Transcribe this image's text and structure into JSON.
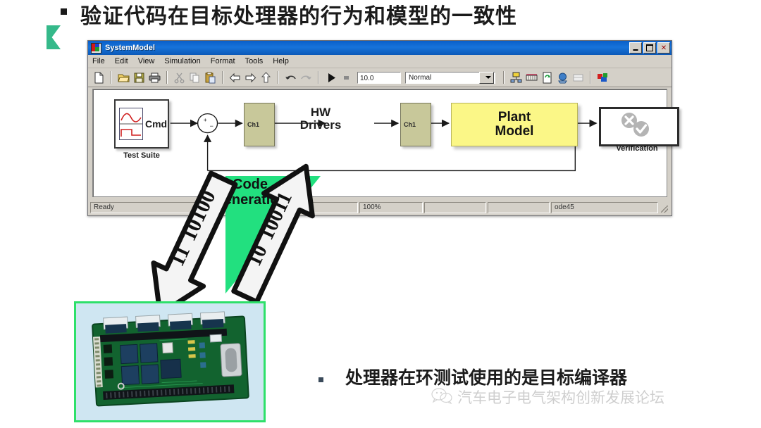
{
  "slide": {
    "bullet": "▪",
    "title": "验证代码在目标处理器的行为和模型的一致性",
    "caption": "处理器在环测试使用的是目标编译器"
  },
  "window": {
    "title": "SystemModel",
    "controls": {
      "minimize": "_",
      "maximize": "□",
      "close": "✕"
    },
    "menus": [
      "File",
      "Edit",
      "View",
      "Simulation",
      "Format",
      "Tools",
      "Help"
    ],
    "toolbar": {
      "icons": [
        "new-file-icon",
        "open-folder-icon",
        "save-icon",
        "print-icon",
        "cut-icon",
        "copy-icon",
        "paste-icon",
        "back-arrow-icon",
        "forward-arrow-icon",
        "up-arrow-icon",
        "undo-icon",
        "redo-icon",
        "run-icon",
        "stop-icon"
      ],
      "right_icons": [
        "model-browser-icon",
        "library-icon",
        "update-diagram-icon",
        "build-icon",
        "debug-icon",
        "scope-icon"
      ],
      "stop_time": "10.0",
      "sim_mode": "Normal"
    },
    "statusbar": {
      "state": "Ready",
      "field_a": "",
      "zoom": "100%",
      "field_b": "",
      "field_c": "",
      "solver": "ode45"
    }
  },
  "diagram": {
    "test_suite": {
      "port_label": "Cmd",
      "caption": "Test Suite",
      "icon": "signal-plot-icon"
    },
    "sum_block": {
      "plus": "+",
      "minus": "−",
      "name": "sum-junction"
    },
    "hw_in": {
      "port_label": "Ch1"
    },
    "hw_drivers_label_line1": "HW",
    "hw_drivers_label_line2": "Drivers",
    "hw_out": {
      "port_label": "Ch1"
    },
    "plant": {
      "line1": "Plant",
      "line2": "Model"
    },
    "verification": {
      "caption": "Verification",
      "icons": [
        "fail-cross-icon",
        "pass-check-icon"
      ]
    }
  },
  "codegen": {
    "label_line1": "Code",
    "label_line2": "Generation",
    "down_arrow_bits": "10100 11",
    "up_arrow_bits": "11001 01",
    "colors": {
      "wedge": "#22e07f",
      "arrow_fill": "#ffffff",
      "arrow_stroke": "#111111"
    }
  },
  "board": {
    "name": "embedded-target-board-photo",
    "background": "#cfe6f2",
    "border": "#2ee06a"
  },
  "watermark": {
    "icon": "wechat-icon",
    "text": "汽车电子电气架构创新发展论坛"
  },
  "colors": {
    "titlebar_blue": "#1773da",
    "window_face": "#d4d0c8",
    "plant_yellow": "#fbf787",
    "ch_block_olive": "#c8c89a",
    "accent_green": "#35b98a"
  }
}
